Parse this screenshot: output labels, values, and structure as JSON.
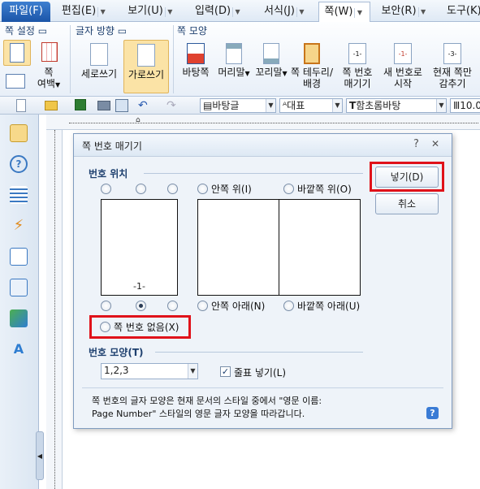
{
  "menubar": {
    "items": [
      {
        "label": "파일(F)"
      },
      {
        "label": "편집(E)"
      },
      {
        "label": "보기(U)"
      },
      {
        "label": "입력(D)"
      },
      {
        "label": "서식(J)"
      },
      {
        "label": "쪽(W)"
      },
      {
        "label": "보안(R)"
      },
      {
        "label": "도구(K)"
      }
    ]
  },
  "ribbon": {
    "groups": {
      "page_setup": "쪽 설정",
      "text_direction": "글자 방향",
      "page_style": "쪽 모양"
    },
    "buttons": {
      "margin": "쪽\n여백",
      "vertical": "세로쓰기",
      "horizontal": "가로쓰기",
      "background": "바탕쪽",
      "header": "머리말",
      "footer": "꼬리말",
      "border_l1": "쪽 테두리/",
      "border_l2": "배경",
      "pagenum_l1": "쪽 번호",
      "pagenum_l2": "매기기",
      "newnum_l1": "새 번호로",
      "newnum_l2": "시작",
      "hide_l1": "현재 쪽만",
      "hide_l2": "감추기"
    }
  },
  "toolbar": {
    "style": "바탕글",
    "lang": "대표",
    "font": "함초롬바탕",
    "size": "10.0"
  },
  "dialog": {
    "title": "쪽 번호 매기기",
    "help": "?",
    "close": "✕",
    "position_label": "번호 위치",
    "inner_top": "안쪽 위(I)",
    "outer_top": "바깥쪽 위(O)",
    "inner_bottom": "안쪽 아래(N)",
    "outer_bottom": "바깥쪽 아래(U)",
    "no_number": "쪽 번호 없음(X)",
    "page_number_sample": "-1-",
    "shape_label": "번호 모양(T)",
    "shape_value": "1,2,3",
    "dash_label": "줄표 넣기(L)",
    "dash_checked": true,
    "note_line1": "쪽 번호의 글자 모양은 현재 문서의 스타일 중에서 \"영문 이름:",
    "note_line2": "Page Number\" 스타일의 영문 글자 모양을 따라갑니다.",
    "insert_button": "넣기(D)",
    "cancel_button": "취소",
    "selected_position": "bottom-center"
  },
  "colors": {
    "highlight": "#e0121a",
    "accent": "#1c55a8"
  }
}
